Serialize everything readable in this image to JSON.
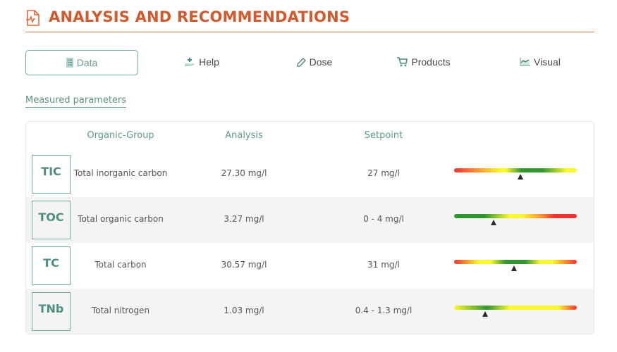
{
  "header": {
    "title": "ANALYSIS AND RECOMMENDATIONS",
    "icon": "document-pulse-icon",
    "color": "#d5582a"
  },
  "tabs": [
    {
      "label": "Data",
      "icon": "list-icon",
      "active": true
    },
    {
      "label": "Help",
      "icon": "hand-plus-icon",
      "active": false
    },
    {
      "label": "Dose",
      "icon": "pipette-icon",
      "active": false
    },
    {
      "label": "Products",
      "icon": "cart-icon",
      "active": false
    },
    {
      "label": "Visual",
      "icon": "chart-line-icon",
      "active": false
    }
  ],
  "section": {
    "title": "Measured parameters"
  },
  "table": {
    "headers": {
      "group": "Organic-Group",
      "analysis": "Analysis",
      "setpoint": "Setpoint"
    },
    "rows": [
      {
        "code": "TIC",
        "name": "Total inorganic carbon",
        "analysis": "27.30 mg/l",
        "setpoint": "27 mg/l",
        "gauge_type": "centered",
        "gauge_position": 0.54
      },
      {
        "code": "TOC",
        "name": "Total organic carbon",
        "analysis": "3.27 mg/l",
        "setpoint": "0 - 4 mg/l",
        "gauge_type": "low-good",
        "gauge_position": 0.32
      },
      {
        "code": "TC",
        "name": "Total carbon",
        "analysis": "30.57 mg/l",
        "setpoint": "31 mg/l",
        "gauge_type": "centered-symmetric",
        "gauge_position": 0.49
      },
      {
        "code": "TNb",
        "name": "Total nitrogen",
        "analysis": "1.03 mg/l",
        "setpoint": "0.4 - 1.3 mg/l",
        "gauge_type": "range",
        "gauge_position": 0.25
      }
    ]
  },
  "colors": {
    "accent": "#72aba1",
    "red": "#f53131",
    "orange": "#f99a30",
    "yellow": "#f9f92c",
    "green": "#2f962f"
  }
}
